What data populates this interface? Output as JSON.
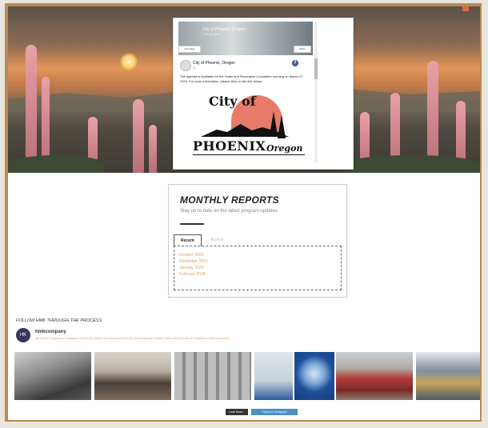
{
  "facebook": {
    "cover_title": "City of Phoenix, Oregon",
    "cover_sub": "1.4K followers",
    "like_label": "Like Page",
    "share_label": "Share",
    "page_name": "City of Phoenix, Oregon",
    "post_meta": "2d",
    "post_text": "The agenda is available for the Parks and Recreation Committee meeting on March 27, 2024. For more information, please click on the link below.",
    "logo_city": "City of",
    "logo_phoenix": "PHOENIX",
    "logo_oregon": "Oregon"
  },
  "reports": {
    "title": "MONTHLY REPORTS",
    "subtitle": "Stay up to date on the latest program updates",
    "tabs": [
      "Recent",
      "Archive"
    ],
    "items": [
      "October 2023",
      "November 2023",
      "January 2024",
      "February 2024"
    ]
  },
  "follow": {
    "title": "FOLLOW HMK THROUGH THE PROCESS",
    "handle": "hmkcompany",
    "avatar_text": "HK",
    "description": "We are the company on Instagram of the build, design and development of the new community projects. Follow along to see our progress on the construction."
  },
  "buttons": {
    "load_more": "Load More...",
    "follow_ig": "Follow on Instagram"
  },
  "colors": {
    "accent": "#e0a060",
    "frame": "#b88b52",
    "button_blue": "#4a90c8"
  }
}
